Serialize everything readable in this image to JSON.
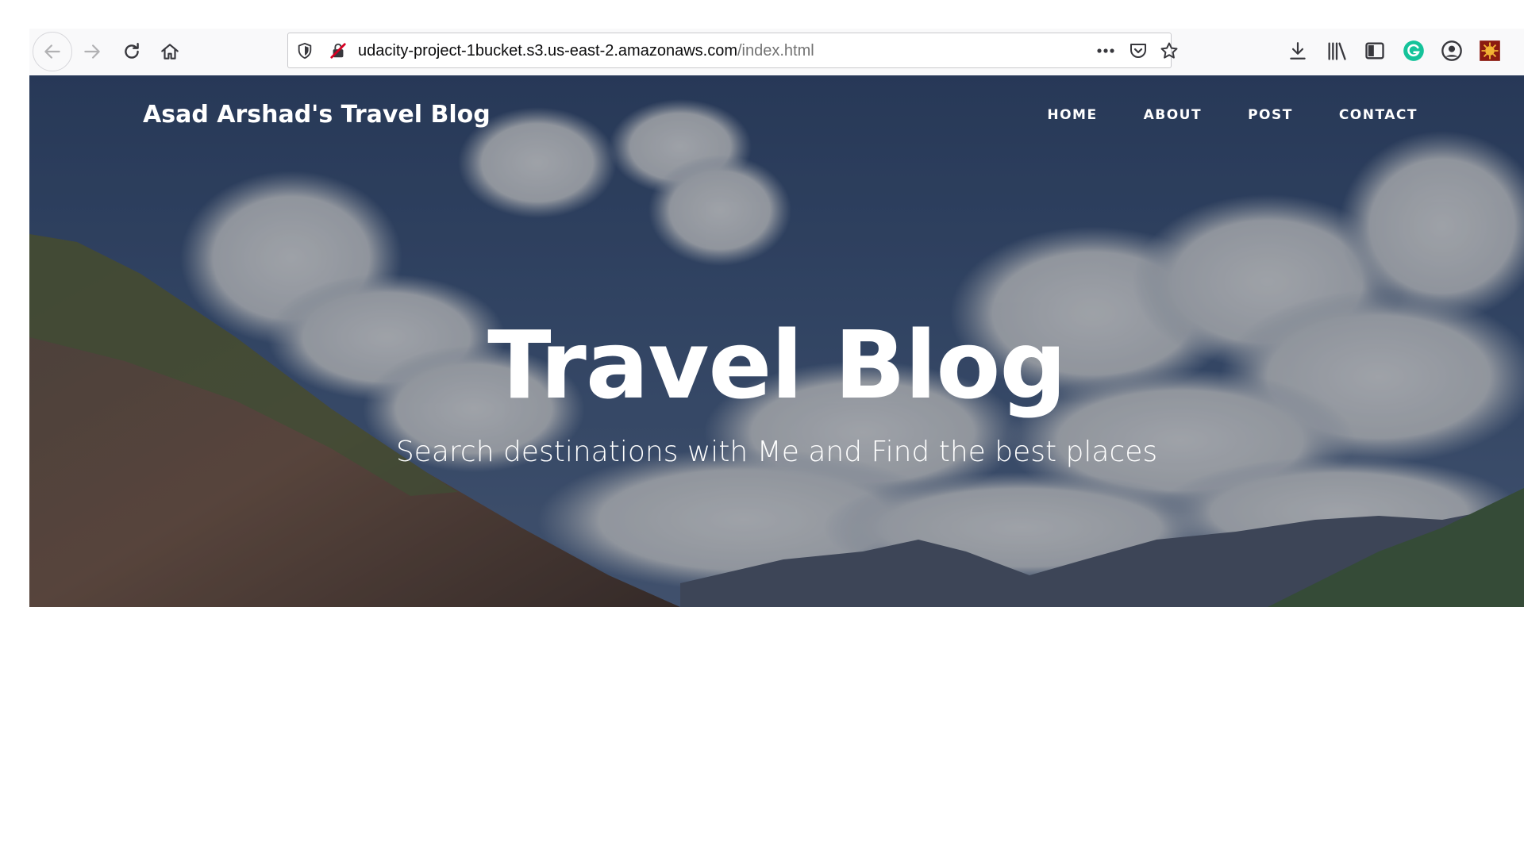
{
  "browser": {
    "url_host": "udacity-project-1bucket.s3.us-east-2.amazonaws.com",
    "url_path": "/index.html",
    "icons": {
      "back": "back-arrow-icon",
      "forward": "forward-arrow-icon",
      "reload": "reload-icon",
      "home": "home-icon",
      "shield": "tracking-protection-shield-icon",
      "insecure": "insecure-lock-icon",
      "more": "more-actions-icon",
      "pocket": "pocket-icon",
      "bookmark": "bookmark-star-icon",
      "download": "download-icon",
      "library": "library-icon",
      "sidebar": "sidebar-icon",
      "grammarly": "grammarly-icon",
      "account": "account-icon",
      "extension": "extension-icon"
    }
  },
  "site": {
    "brand": "Asad Arshad's Travel Blog",
    "nav": [
      "HOME",
      "ABOUT",
      "POST",
      "CONTACT"
    ],
    "hero_title": "Travel Blog",
    "hero_subtitle": "Search destinations with Me and Find the best places"
  },
  "colors": {
    "sky": "#33476a",
    "grammarly": "#15c39a",
    "extension": "#c0392b"
  }
}
